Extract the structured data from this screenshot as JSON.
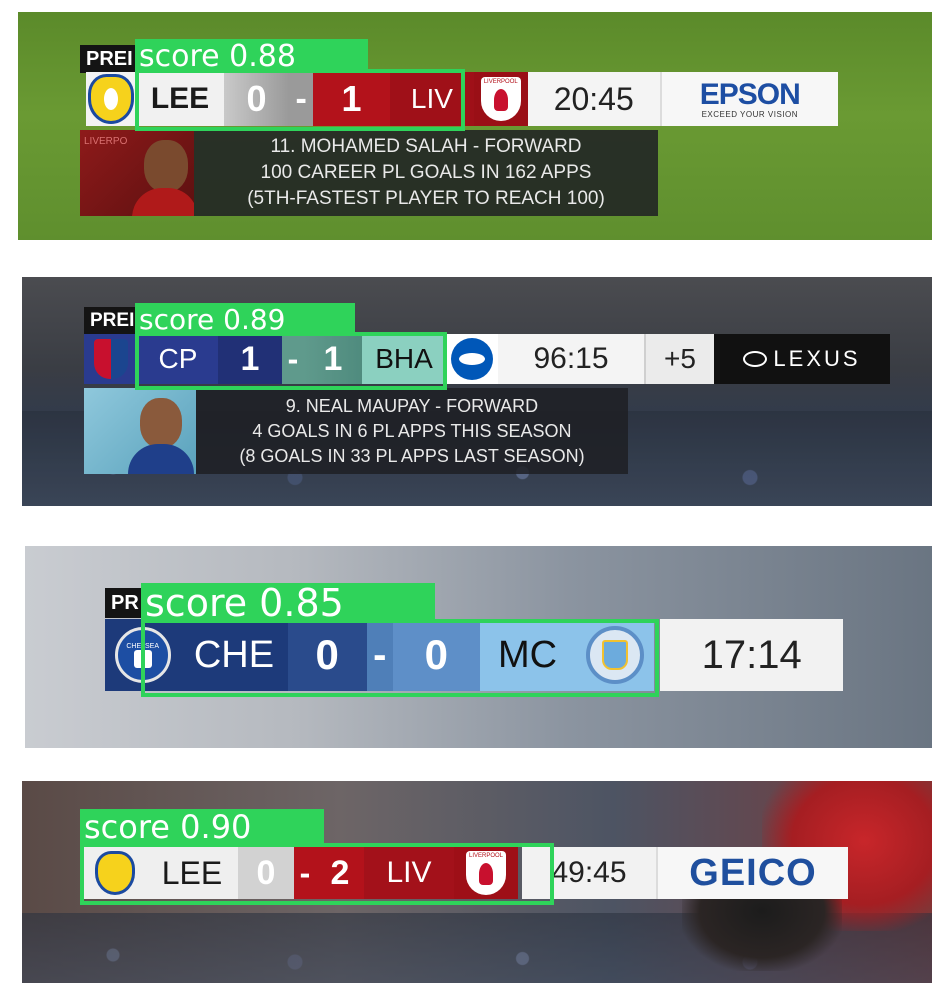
{
  "panels": [
    {
      "prem_text": "PREI",
      "home": "LEE",
      "home_score": "0",
      "dash": "-",
      "away_score": "1",
      "away": "LIV",
      "clock": "20:45",
      "sponsor": "EPSON",
      "sponsor_tagline": "EXCEED YOUR VISION",
      "crest_text": "LIVERPOOL",
      "detection_label": "score 0.88",
      "info": {
        "line1": "11. MOHAMED SALAH - FORWARD",
        "line2": "100 CAREER PL GOALS IN 162 APPS",
        "line3": "(5TH-FASTEST PLAYER TO REACH 100)",
        "photo_text": "LIVERPO"
      }
    },
    {
      "prem_text": "PREI",
      "home": "CP",
      "home_score": "1",
      "dash": "-",
      "away_score": "1",
      "away": "BHA",
      "clock": "96:15",
      "added_time": "+5",
      "sponsor": "LEXUS",
      "detection_label": "score 0.89",
      "info": {
        "line1": "9. NEAL MAUPAY - FORWARD",
        "line2": "4 GOALS IN 6 PL APPS THIS SEASON",
        "line3": "(8 GOALS IN 33 PL APPS LAST SEASON)"
      }
    },
    {
      "prem_text": "PR",
      "home": "CHE",
      "home_score": "0",
      "dash": "-",
      "away_score": "0",
      "away": "MC",
      "clock": "17:14",
      "crest_text": "CHELSEA",
      "detection_label": "score 0.85"
    },
    {
      "home": "LEE",
      "home_score": "0",
      "dash": "-",
      "away_score": "2",
      "away": "LIV",
      "clock": "49:45",
      "sponsor": "GEICO",
      "crest_text": "LIVERPOOL",
      "detection_label": "score 0.90"
    }
  ],
  "colors": {
    "detection_green": "#2fd35a",
    "liverpool_red": "#b3121b",
    "crystal_palace_blue": "#2a3b8f",
    "brighton_teal": "#6fb7a9",
    "chelsea_blue": "#1d3a7a",
    "man_city_sky": "#8cc3ea",
    "epson_blue": "#1d4ea3",
    "geico_blue": "#1f4f9e"
  },
  "icons": [
    "leeds-crest-icon",
    "liverpool-crest-icon",
    "crystal-palace-crest-icon",
    "brighton-crest-icon",
    "chelsea-crest-icon",
    "man-city-crest-icon",
    "lexus-logo-icon"
  ]
}
